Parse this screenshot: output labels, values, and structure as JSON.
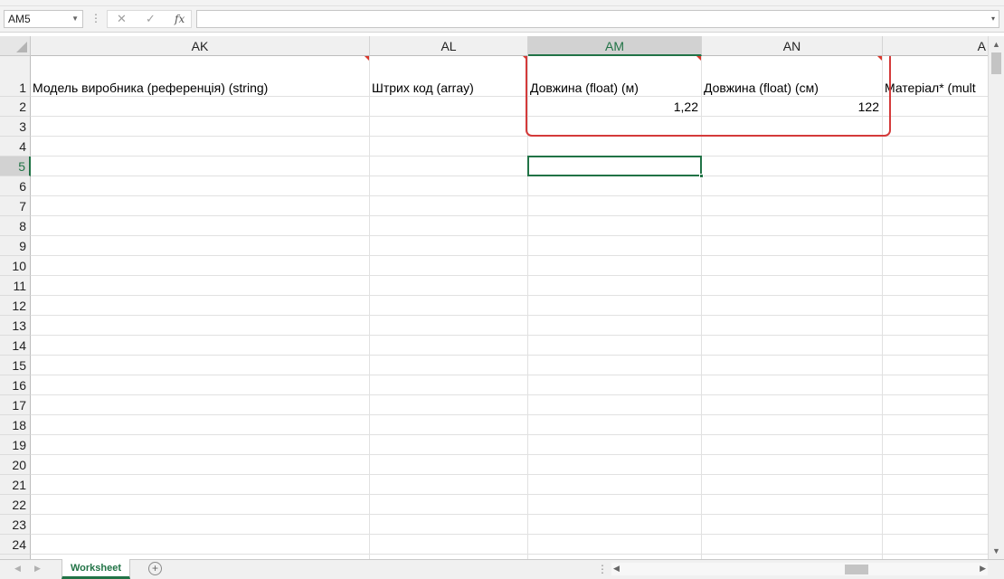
{
  "formula_bar": {
    "name_box": "AM5",
    "cancel_icon": "✕",
    "enter_icon": "✓",
    "fx_label": "fx",
    "formula": ""
  },
  "columns": [
    {
      "id": "AK",
      "label": "AK"
    },
    {
      "id": "AL",
      "label": "AL"
    },
    {
      "id": "AM",
      "label": "AM",
      "selected": true
    },
    {
      "id": "AN",
      "label": "AN"
    },
    {
      "id": "AO",
      "label": "A"
    }
  ],
  "rows": [
    "1",
    "2",
    "3",
    "4",
    "5",
    "6",
    "7",
    "8",
    "9",
    "10",
    "11",
    "12",
    "13",
    "14",
    "15",
    "16",
    "17",
    "18",
    "19",
    "20",
    "21",
    "22",
    "23",
    "24"
  ],
  "selected_row": "5",
  "cells": {
    "AK1": "Модель виробника (референція) (string)",
    "AL1": "Штрих код (array)",
    "AM1": "Довжина (float) (м)",
    "AN1": "Довжина (float) (см)",
    "AO1": "Матеріал* (mult",
    "AM2": "1,22",
    "AN2": "122"
  },
  "sheets": [
    {
      "label": "Worksheet",
      "active": true
    }
  ],
  "add_sheet_icon": "+",
  "colors": {
    "accent": "#217346",
    "annotation": "#d43a3a",
    "comment_marker": "#d9362a"
  }
}
